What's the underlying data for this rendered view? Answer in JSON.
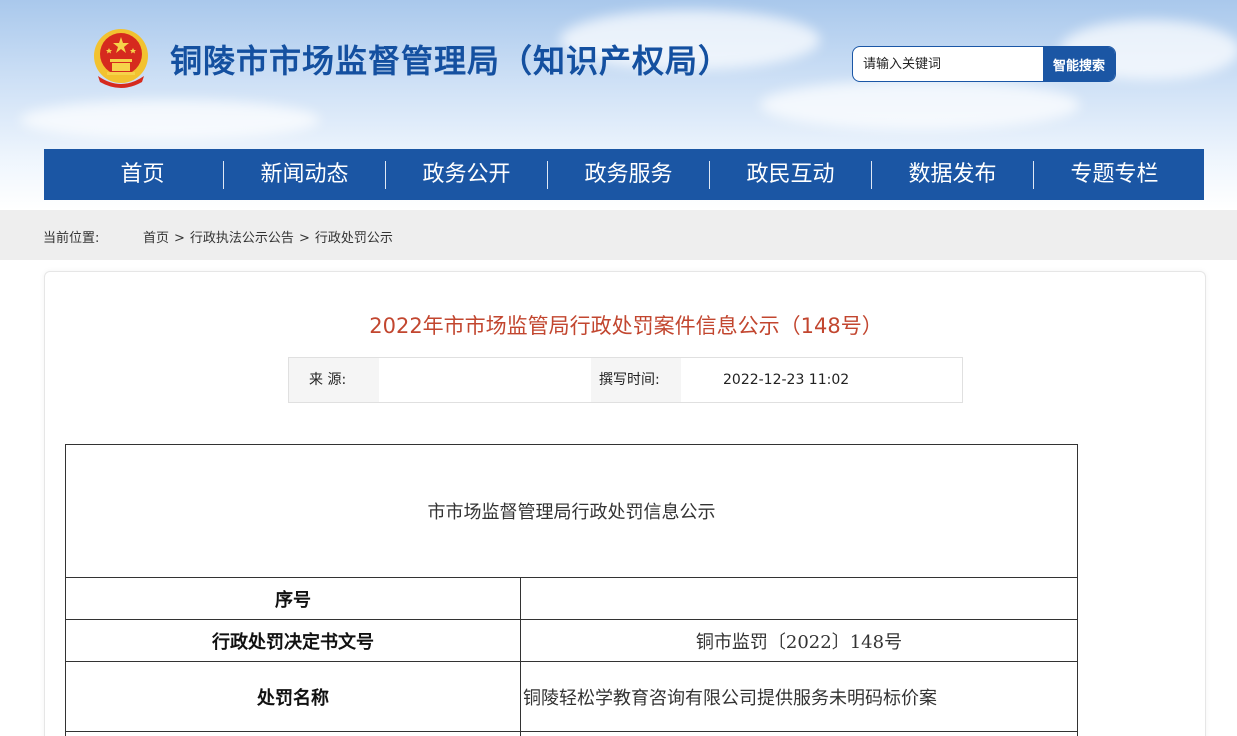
{
  "header": {
    "site_title": "铜陵市市场监督管理局（知识产权局）",
    "search": {
      "placeholder": "请输入关键词",
      "button_label": "智能搜索"
    }
  },
  "nav": {
    "items": [
      {
        "label": "首页"
      },
      {
        "label": "新闻动态"
      },
      {
        "label": "政务公开"
      },
      {
        "label": "政务服务"
      },
      {
        "label": "政民互动"
      },
      {
        "label": "数据发布"
      },
      {
        "label": "专题专栏"
      }
    ]
  },
  "breadcrumb": {
    "label": "当前位置:",
    "items": [
      "首页",
      "行政执法公示公告",
      "行政处罚公示"
    ],
    "separator": ">"
  },
  "article": {
    "title": "2022年市市场监管局行政处罚案件信息公示（148号）",
    "source_label": "来 源:",
    "source_value": "",
    "time_label": "撰写时间:",
    "time_value": "2022-12-23 11:02"
  },
  "table": {
    "heading": "市市场监督管理局行政处罚信息公示",
    "rows": [
      {
        "key": "序号",
        "value": ""
      },
      {
        "key": "行政处罚决定书文号",
        "value": "铜市监罚〔2022〕148号"
      },
      {
        "key": "处罚名称",
        "value": "铜陵轻松学教育咨询有限公司提供服务未明码标价案"
      },
      {
        "key": "",
        "value": ""
      }
    ]
  },
  "colors": {
    "brand_blue": "#1b56a4",
    "title_red": "#c2462f"
  }
}
